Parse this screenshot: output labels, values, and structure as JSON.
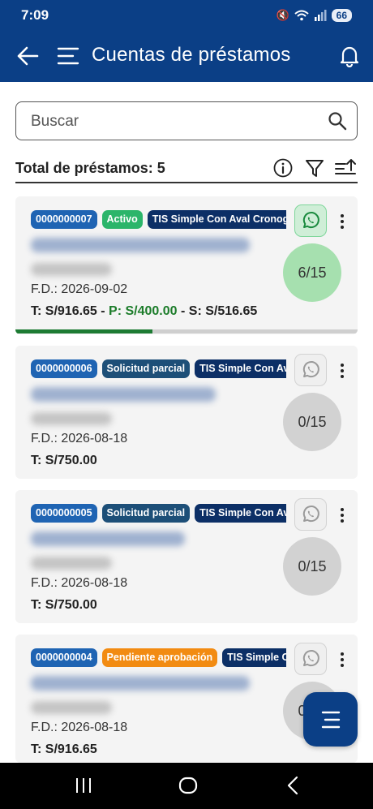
{
  "status_bar": {
    "time": "7:09",
    "battery": "66"
  },
  "header": {
    "title": "Cuentas de préstamos"
  },
  "search": {
    "placeholder": "Buscar"
  },
  "summary": {
    "total_label": "Total de préstamos: 5"
  },
  "loans": [
    {
      "id": "0000000007",
      "status": "Activo",
      "product": "TIS Simple Con Aval Cronograma",
      "fd": "F.D.: 2026-09-02",
      "total": "T: S/916.65",
      "paid": "P: S/400.00",
      "balance": "S: S/516.65",
      "installments": "6/15",
      "progress": 0.4
    },
    {
      "id": "0000000006",
      "status": "Solicitud parcial",
      "product": "TIS Simple Con Aval",
      "fd": "F.D.: 2026-08-18",
      "total": "T: S/750.00",
      "installments": "0/15"
    },
    {
      "id": "0000000005",
      "status": "Solicitud parcial",
      "product": "TIS Simple Con Aval",
      "fd": "F.D.: 2026-08-18",
      "total": "T: S/750.00",
      "installments": "0/15"
    },
    {
      "id": "0000000004",
      "status": "Pendiente aprobación",
      "product": "TIS Simple Con Aval",
      "fd": "F.D.: 2026-08-18",
      "total": "T: S/916.65",
      "installments": "0/15"
    }
  ],
  "colors": {
    "primary": "#0b3f86",
    "active": "#2bb56a",
    "pending": "#f28b12",
    "partial": "#1d4f78",
    "paid_text": "#1c7c2a"
  }
}
